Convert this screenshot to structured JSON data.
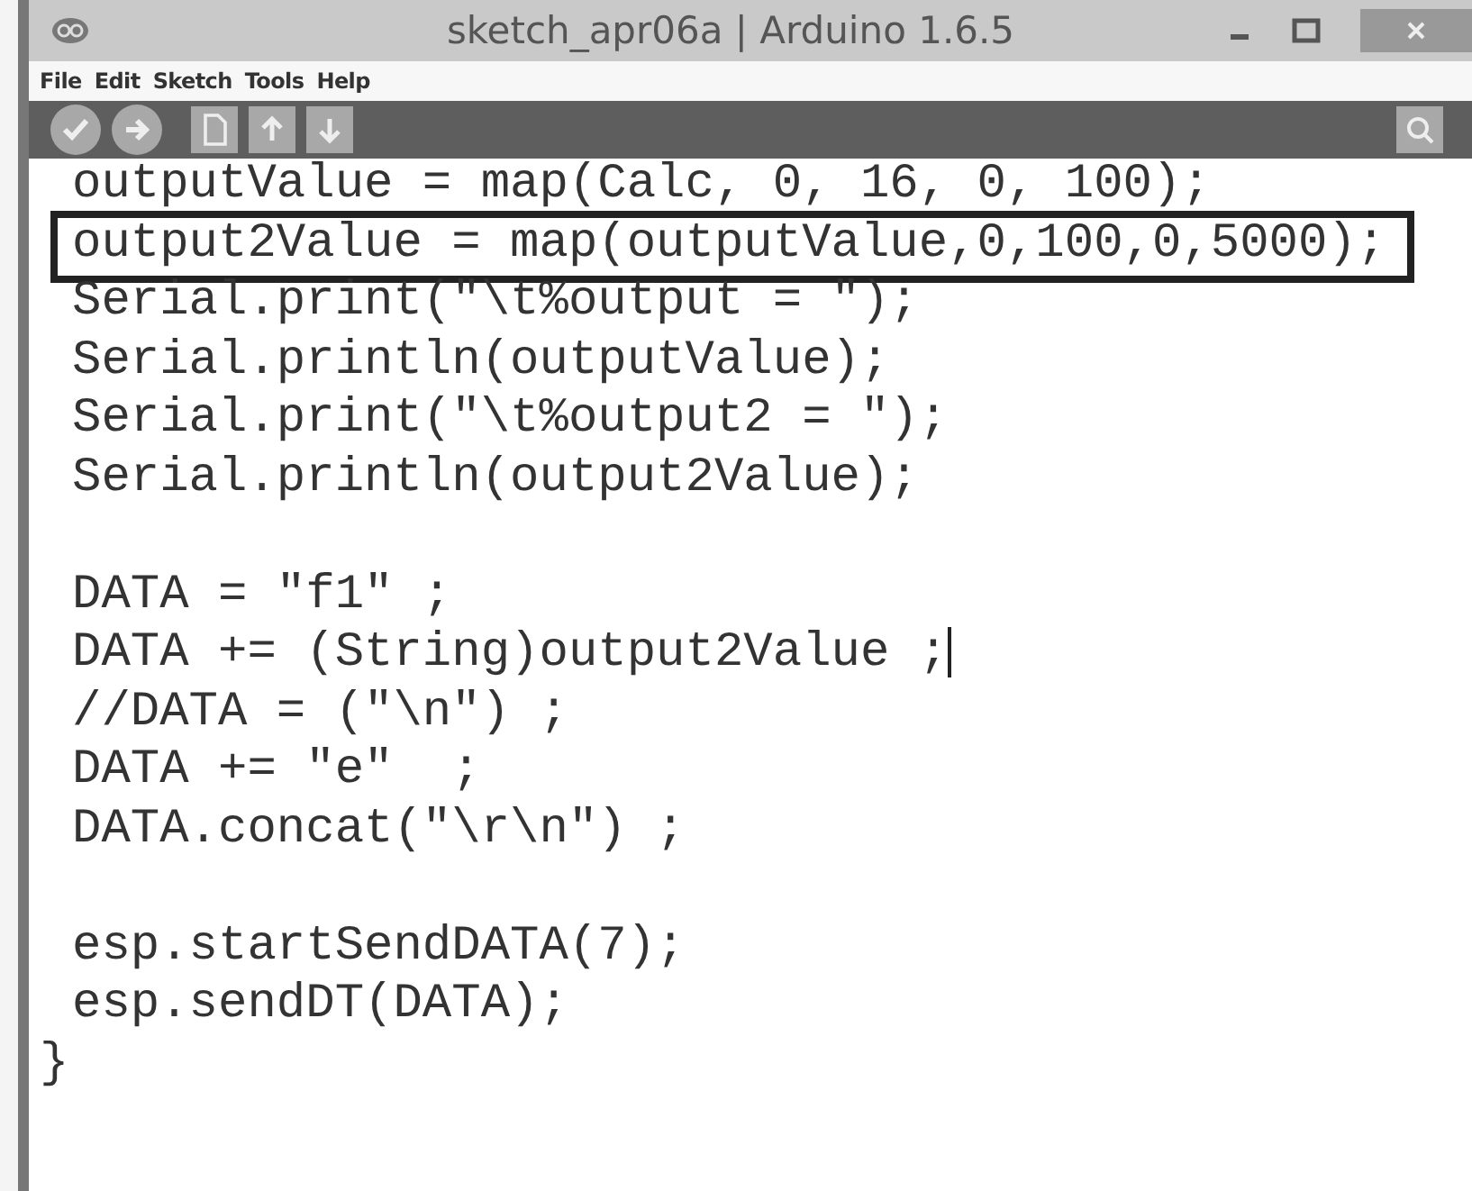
{
  "window": {
    "title": "sketch_apr06a | Arduino 1.6.5"
  },
  "menu": [
    "File",
    "Edit",
    "Sketch",
    "Tools",
    "Help"
  ],
  "editor": {
    "lines": [
      {
        "kind": "code",
        "text": "outputValue = map(Calc, 0, 16, 0, 100);",
        "highlighted": false,
        "caret": false
      },
      {
        "kind": "code",
        "text": "output2Value = map(outputValue,0,100,0,5000);",
        "highlighted": true,
        "caret": false
      },
      {
        "kind": "code",
        "text": "Serial.print(\"\\t%output = \");",
        "highlighted": false,
        "caret": false
      },
      {
        "kind": "code",
        "text": "Serial.println(outputValue);",
        "highlighted": false,
        "caret": false
      },
      {
        "kind": "code",
        "text": "Serial.print(\"\\t%output2 = \");",
        "highlighted": false,
        "caret": false
      },
      {
        "kind": "code",
        "text": "Serial.println(output2Value);",
        "highlighted": false,
        "caret": false
      },
      {
        "kind": "blank"
      },
      {
        "kind": "code",
        "text": "DATA = \"f1\" ;",
        "highlighted": false,
        "caret": false
      },
      {
        "kind": "code",
        "text": "DATA += (String)output2Value ;",
        "highlighted": false,
        "caret": true
      },
      {
        "kind": "code",
        "text": "//DATA = (\"\\n\") ;",
        "highlighted": false,
        "caret": false
      },
      {
        "kind": "code",
        "text": "DATA += \"e\"  ;",
        "highlighted": false,
        "caret": false
      },
      {
        "kind": "code",
        "text": "DATA.concat(\"\\r\\n\") ;",
        "highlighted": false,
        "caret": false
      },
      {
        "kind": "blank"
      },
      {
        "kind": "code",
        "text": "esp.startSendDATA(7);",
        "highlighted": false,
        "caret": false
      },
      {
        "kind": "code",
        "text": "esp.sendDT(DATA);",
        "highlighted": false,
        "caret": false
      },
      {
        "kind": "brace",
        "text": "}",
        "highlighted": false,
        "caret": false
      }
    ]
  }
}
